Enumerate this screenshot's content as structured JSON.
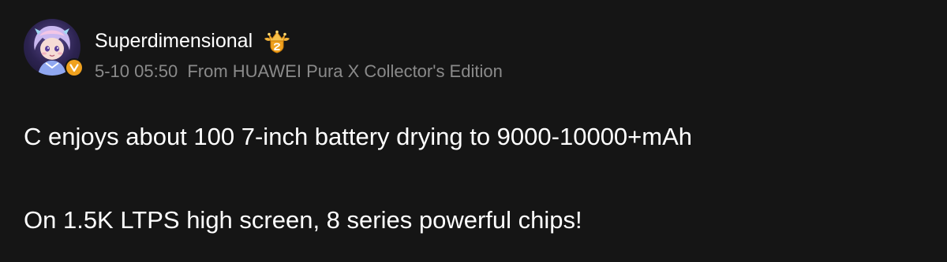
{
  "post": {
    "author": {
      "name": "Superdimensional",
      "avatar_icon": "anime-character-avatar",
      "verified_icon": "verified-v-badge",
      "rank_icon": "crown-rank-badge"
    },
    "meta": {
      "time": "5-10 05:50",
      "source": "From HUAWEI Pura X Collector's Edition"
    },
    "body": [
      "C enjoys about 100 7-inch battery drying to 9000-10000+mAh",
      "On 1.5K LTPS high screen, 8 series powerful chips!"
    ]
  },
  "colors": {
    "background": "#151515",
    "text": "#ffffff",
    "meta_text": "#8a8a8a",
    "badge": "#f0a11e"
  }
}
